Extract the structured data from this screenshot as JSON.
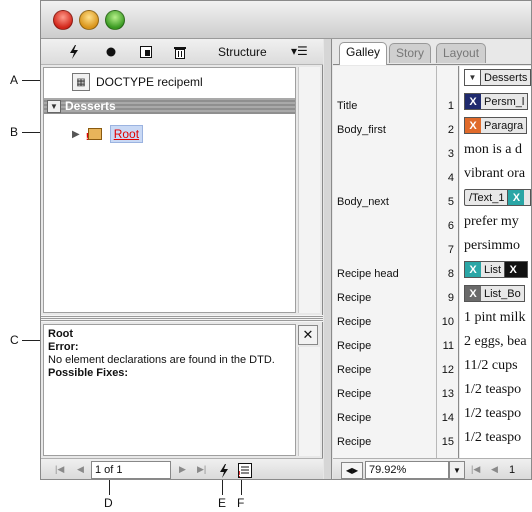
{
  "callouts": {
    "a": "A",
    "b": "B",
    "c": "C",
    "d": "D",
    "e": "E",
    "f": "F"
  },
  "structure_pane": {
    "title": "Structure",
    "menu_icon": "panel-menu-icon",
    "toolbar_icons": [
      "lightning-icon",
      "dot-icon",
      "add-tag-icon",
      "trash-icon"
    ],
    "doctype_label": "DOCTYPE recipeml",
    "section_bar_label": "Desserts",
    "root_label": "Root"
  },
  "info_panel": {
    "element_name": "Root",
    "error_heading": "Error:",
    "error_message": "No element declarations are found in the DTD.",
    "fixes_heading": "Possible Fixes:"
  },
  "pager": {
    "page_value": "1 of 1"
  },
  "story_editor": {
    "tabs": [
      {
        "label": "Galley",
        "active": true
      },
      {
        "label": "Story",
        "active": false
      },
      {
        "label": "Layout",
        "active": false
      }
    ],
    "rows": [
      {
        "tag": "",
        "num": ""
      },
      {
        "tag": "Title",
        "num": "1"
      },
      {
        "tag": "Body_first",
        "num": "2"
      },
      {
        "tag": "",
        "num": "3"
      },
      {
        "tag": "",
        "num": "4"
      },
      {
        "tag": "Body_next",
        "num": "5"
      },
      {
        "tag": "",
        "num": "6"
      },
      {
        "tag": "",
        "num": "7"
      },
      {
        "tag": "Recipe head",
        "num": "8"
      },
      {
        "tag": "Recipe",
        "num": "9"
      },
      {
        "tag": "Recipe",
        "num": "10"
      },
      {
        "tag": "Recipe",
        "num": "11"
      },
      {
        "tag": "Recipe",
        "num": "12"
      },
      {
        "tag": "Recipe",
        "num": "13"
      },
      {
        "tag": "Recipe",
        "num": "14"
      },
      {
        "tag": "Recipe",
        "num": "15"
      }
    ],
    "content": {
      "r0_chip": "Desserts",
      "r1_chip": "Persm_l",
      "r2_chip": "Paragra",
      "r3_text": "mon is a d",
      "r4_text": "vibrant ora",
      "r5_chip": "/Text_1",
      "r6_text": "prefer my",
      "r7_text": "persimmo",
      "r8_chip": "List",
      "r9_chip": "List_Bo",
      "r10_text": "1 pint milk",
      "r11_text": "2 eggs, bea",
      "r12_text": "11/2 cups",
      "r13_text": "1/2 teaspo",
      "r14_text": "1/2 teaspo",
      "r15_text": "1/2 teaspo"
    },
    "zoom_value": "79.92%",
    "page_indicator": "1"
  },
  "colors": {
    "error_red": "#e10000",
    "tag_navy": "#1f2a6e",
    "tag_orange": "#e06a2a",
    "tag_teal": "#2aa6a6"
  }
}
